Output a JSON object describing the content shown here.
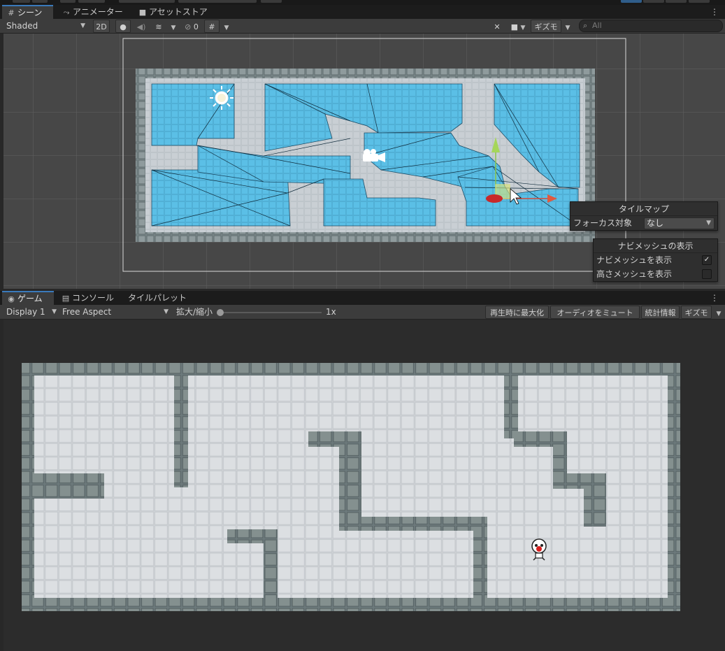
{
  "scene_tabs": {
    "scene": "シーン",
    "animator": "アニメーター",
    "asset_store": "アセットストア"
  },
  "scene_toolbar": {
    "shading_mode": "Shaded",
    "mode_2d": "2D",
    "hidden_count": "0",
    "gizmos": "ギズモ",
    "search_placeholder": "All"
  },
  "tilemap_overlay": {
    "title": "タイルマップ",
    "focus_label": "フォーカス対象",
    "focus_value": "なし"
  },
  "navmesh_overlay": {
    "title": "ナビメッシュの表示",
    "show_navmesh_label": "ナビメッシュを表示",
    "show_navmesh_checked": true,
    "show_height_mesh_label": "高さメッシュを表示",
    "show_height_mesh_checked": false,
    "check_glyph": "✓"
  },
  "bottom_tabs": {
    "game": "ゲーム",
    "console": "コンソール",
    "tile_palette": "タイルパレット"
  },
  "game_toolbar": {
    "display": "Display 1",
    "aspect": "Free Aspect",
    "scale_label": "拡大/縮小",
    "scale_value": "1x",
    "maximize_on_play": "再生時に最大化",
    "mute_audio": "オーディオをミュート",
    "stats": "統計情報",
    "gizmos": "ギズモ"
  },
  "colors": {
    "navmesh": "#5bbfe6",
    "floor_scene": "#c9cfd4",
    "floor_game": "#d4d7da",
    "wall": "#7f8c8e",
    "wall_dark": "#5c6a6c",
    "accent_tab": "#3a79bb"
  },
  "icons": {
    "scene_tab": "grid-icon",
    "animator_tab": "animator-icon",
    "asset_store_tab": "bag-icon",
    "game_tab": "gamepad-icon",
    "console_tab": "console-icon",
    "light": "directional-light-icon",
    "camera": "camera-icon",
    "player": "skull-character-icon"
  }
}
